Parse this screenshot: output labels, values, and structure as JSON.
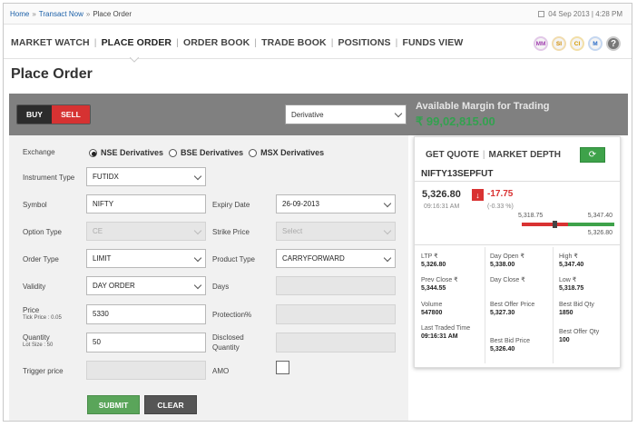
{
  "breadcrumb": {
    "home": "Home",
    "transact": "Transact Now",
    "current": "Place Order",
    "sep": "»"
  },
  "datetime": "04 Sep 2013 | 4:28 PM",
  "nav": {
    "items": [
      {
        "label": "MARKET WATCH",
        "active": false
      },
      {
        "label": "PLACE ORDER",
        "active": true
      },
      {
        "label": "ORDER BOOK",
        "active": false
      },
      {
        "label": "TRADE BOOK",
        "active": false
      },
      {
        "label": "POSITIONS",
        "active": false
      },
      {
        "label": "FUNDS VIEW",
        "active": false
      }
    ],
    "sep": "|"
  },
  "circles": [
    "MM",
    "SI",
    "CI",
    "M",
    "?"
  ],
  "page_title": "Place Order",
  "order": {
    "buy_label": "BUY",
    "sell_label": "SELL",
    "segment": "Derivative",
    "exchange_label": "Exchange",
    "exchanges": [
      "NSE Derivatives",
      "BSE Derivatives",
      "MSX Derivatives"
    ],
    "instrument_type_label": "Instrument Type",
    "instrument_type": "FUTIDX",
    "symbol_label": "Symbol",
    "symbol": "NIFTY",
    "expiry_label": "Expiry Date",
    "expiry": "26-09-2013",
    "option_type_label": "Option Type",
    "option_type": "CE",
    "strike_label": "Strike Price",
    "strike_placeholder": "Select",
    "order_type_label": "Order Type",
    "order_type": "LIMIT",
    "product_type_label": "Product Type",
    "product_type": "CARRYFORWARD",
    "validity_label": "Validity",
    "validity": "DAY ORDER",
    "days_label": "Days",
    "price_label": "Price",
    "price_tick": "Tick Price : 0.05",
    "price": "5330",
    "protection_label": "Protection%",
    "quantity_label": "Quantity",
    "lot_size": "Lot Size : 50",
    "quantity": "50",
    "disclosed_label": "Disclosed Quantity",
    "trigger_label": "Trigger price",
    "amo_label": "AMO",
    "submit_label": "SUBMIT",
    "clear_label": "CLEAR"
  },
  "margin": {
    "label": "Available Margin for Trading",
    "value": "₹ 99,02,815.00"
  },
  "quote": {
    "tab_get_quote": "GET QUOTE",
    "tab_market_depth": "MARKET DEPTH",
    "tab_sep": "|",
    "refresh_glyph": "⟳",
    "symbol": "NIFTY13SEPFUT",
    "ltp": "5,326.80",
    "change": "-17.75",
    "change_pct": "(-0.33 %)",
    "time": "09:16:31 AM",
    "day_low": "5,318.75",
    "day_high": "5,347.40",
    "range_position": 0.33,
    "last_value": "5,326.80",
    "stats": {
      "ltp_label": "LTP ₹",
      "ltp": "5,326.80",
      "day_open_label": "Day Open ₹",
      "day_open": "5,338.00",
      "high_label": "High ₹",
      "high": "5,347.40",
      "prev_close_label": "Prev Close ₹",
      "prev_close": "5,344.55",
      "day_close_label": "Day Close ₹",
      "day_close": "",
      "low_label": "Low ₹",
      "low": "5,318.75",
      "volume_label": "Volume",
      "volume": "547800",
      "best_offer_price_label": "Best Offer Price",
      "best_offer_price": "5,327.30",
      "best_bid_qty_label": "Best Bid Qty",
      "best_bid_qty": "1850",
      "last_traded_label": "Last Traded Time",
      "last_traded": "09:16:31 AM",
      "best_bid_price_label": "Best Bid Price",
      "best_bid_price": "5,326.40",
      "best_offer_qty_label": "Best Offer Qty",
      "best_offer_qty": "100"
    }
  },
  "colors": {
    "green": "#3ea24a",
    "red": "#d93232",
    "header_gray": "#808080"
  }
}
